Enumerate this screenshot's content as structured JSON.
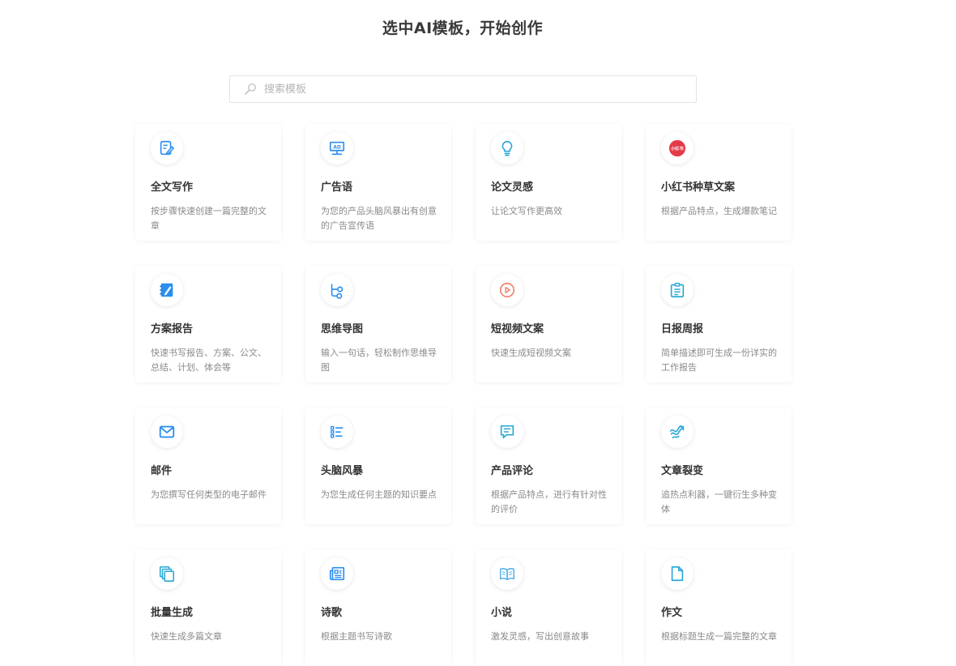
{
  "page": {
    "title": "选中AI模板，开始创作"
  },
  "search": {
    "placeholder": "搜索模板",
    "value": "",
    "icon": "search-icon"
  },
  "colors": {
    "accent_blue": "#2b8ff0",
    "xiaohongshu_red": "#e53b48",
    "video_orange": "#f2826a"
  },
  "templates": [
    {
      "key": "full-article",
      "title": "全文写作",
      "desc": "按步骤快速创建一篇完整的文章",
      "icon": "edit-document-icon"
    },
    {
      "key": "ad-slogan",
      "title": "广告语",
      "desc": "为您的产品头脑风暴出有创意的广告宣传语",
      "icon": "ad-board-icon"
    },
    {
      "key": "paper-inspiration",
      "title": "论文灵感",
      "desc": "让论文写作更高效",
      "icon": "lightbulb-icon"
    },
    {
      "key": "xiaohongshu",
      "title": "小红书种草文案",
      "desc": "根据产品特点，生成爆款笔记",
      "icon": "xiaohongshu-logo-icon",
      "logo_text": "小红书"
    },
    {
      "key": "proposal-report",
      "title": "方案报告",
      "desc": "快速书写报告、方案、公文、总结、计划、体会等",
      "icon": "notebook-pen-icon"
    },
    {
      "key": "mind-map",
      "title": "思维导图",
      "desc": "输入一句话，轻松制作思维导图",
      "icon": "mind-map-icon"
    },
    {
      "key": "short-video",
      "title": "短视频文案",
      "desc": "快速生成短视频文案",
      "icon": "play-circle-icon"
    },
    {
      "key": "daily-weekly",
      "title": "日报周报",
      "desc": "简单描述即可生成一份详实的工作报告",
      "icon": "clipboard-icon"
    },
    {
      "key": "email",
      "title": "邮件",
      "desc": "为您撰写任何类型的电子邮件",
      "icon": "mail-icon"
    },
    {
      "key": "brainstorm",
      "title": "头脑风暴",
      "desc": "为您生成任何主题的知识要点",
      "icon": "checklist-icon"
    },
    {
      "key": "product-review",
      "title": "产品评论",
      "desc": "根据产品特点，进行有针对性的评价",
      "icon": "comment-icon"
    },
    {
      "key": "article-split",
      "title": "文章裂变",
      "desc": "追热点利器，一键衍生多种变体",
      "icon": "wave-arrow-icon"
    },
    {
      "key": "batch-generate",
      "title": "批量生成",
      "desc": "快速生成多篇文章",
      "icon": "copy-stack-icon"
    },
    {
      "key": "poetry",
      "title": "诗歌",
      "desc": "根据主题书写诗歌",
      "icon": "newspaper-icon"
    },
    {
      "key": "novel",
      "title": "小说",
      "desc": "激发灵感，写出创意故事",
      "icon": "open-book-icon"
    },
    {
      "key": "essay",
      "title": "作文",
      "desc": "根据标题生成一篇完整的文章",
      "icon": "file-icon"
    }
  ]
}
